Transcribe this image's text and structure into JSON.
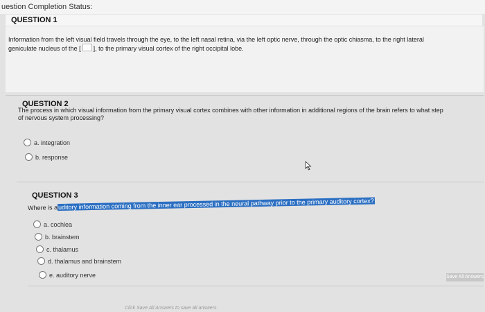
{
  "status": {
    "label": "uestion Completion Status:"
  },
  "questions": [
    {
      "header": "QUESTION 1",
      "text_before": "Information from the left visual field travels through the eye, to the left nasal retina, via the left optic nerve, through the optic chiasma, to the right lateral",
      "text_line2_before": "geniculate nucleus of the [",
      "text_line2_after": "], to the primary visual cortex of the right occipital lobe."
    },
    {
      "header": "QUESTION 2",
      "text_line1": "The process in which visual information from the primary visual cortex combines with other information in additional regions of the brain refers to what step",
      "text_line2": "of nervous system processing?",
      "options": [
        "a. integration",
        "b. response"
      ]
    },
    {
      "header": "QUESTION 3",
      "text_prefix": "Where is a",
      "text_highlight": "uditory information coming from the inner ear processed in the neural pathway prior to the primary auditory cortex?",
      "options": [
        "a. cochlea",
        "b. brainstem",
        "c. thalamus",
        "d. thalamus and brainstem",
        "e. auditory nerve"
      ]
    }
  ],
  "footer": {
    "save_all": "Save All Answers",
    "hint": "Click Save All Answers to save all answers."
  },
  "icons": {
    "cursor": "mouse-pointer-icon"
  }
}
